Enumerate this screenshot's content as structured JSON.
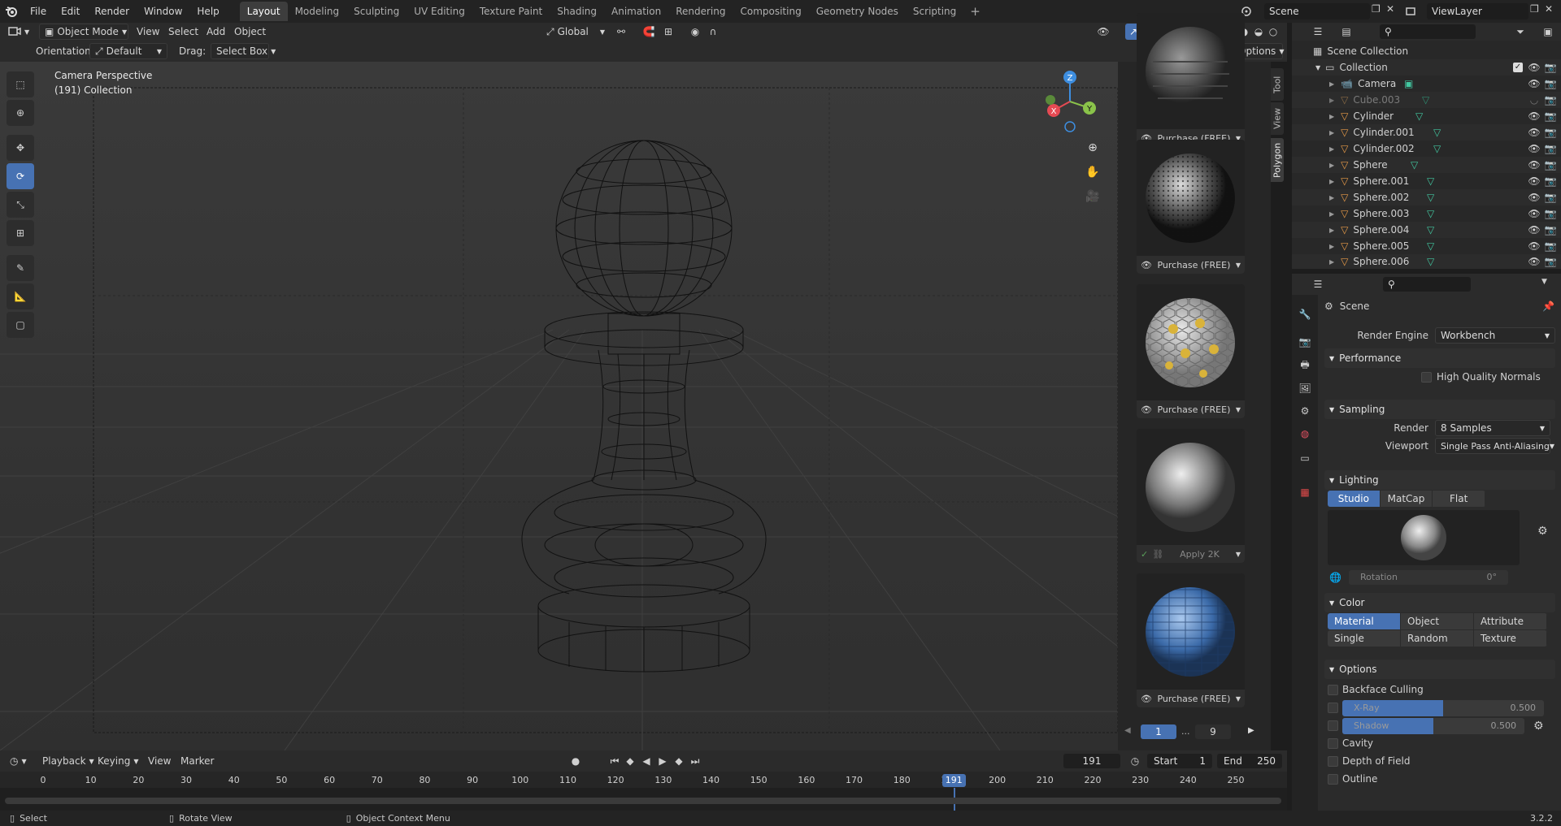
{
  "topbar": {
    "menus": [
      "File",
      "Edit",
      "Render",
      "Window",
      "Help"
    ],
    "workspaces": [
      "Layout",
      "Modeling",
      "Sculpting",
      "UV Editing",
      "Texture Paint",
      "Shading",
      "Animation",
      "Rendering",
      "Compositing",
      "Geometry Nodes",
      "Scripting"
    ],
    "active_workspace": "Layout",
    "scene": "Scene",
    "view_layer": "ViewLayer"
  },
  "viewport_header": {
    "mode": "Object Mode",
    "menus": [
      "View",
      "Select",
      "Add",
      "Object"
    ],
    "transform_orientation": "Global",
    "orientation_label": "Orientation:",
    "orientation_value": "Default",
    "drag_label": "Drag:",
    "drag_value": "Select Box",
    "options": "Options"
  },
  "viewport": {
    "camera_text": "Camera Perspective",
    "collection_text": "(191) Collection",
    "side_tabs": [
      "Tool",
      "View",
      "Polygon"
    ],
    "gizmo_labels": {
      "z": "Z",
      "y": "Y",
      "x": "X"
    }
  },
  "asset_panel": {
    "cards": [
      {
        "label": "Purchase (FREE)",
        "material": "fabric",
        "enabled": true
      },
      {
        "label": "Purchase (FREE)",
        "material": "metal-perforated",
        "enabled": true
      },
      {
        "label": "Purchase (FREE)",
        "material": "hex-tiles",
        "enabled": true
      },
      {
        "label": "Purchase (FREE)",
        "material": "clay",
        "enabled": true
      },
      {
        "label": "Apply 2K",
        "material": "smooth-grey",
        "enabled": false
      },
      {
        "label": "Purchase (FREE)",
        "material": "blue-bricks",
        "enabled": true
      }
    ],
    "page_current": "1",
    "page_sep": "...",
    "page_total": "9"
  },
  "outliner": {
    "root": "Scene Collection",
    "collection": "Collection",
    "items": [
      {
        "name": "Camera",
        "type": "camera",
        "hidden": false
      },
      {
        "name": "Cube.003",
        "type": "mesh",
        "hidden": true
      },
      {
        "name": "Cylinder",
        "type": "mesh",
        "hidden": false
      },
      {
        "name": "Cylinder.001",
        "type": "mesh",
        "hidden": false
      },
      {
        "name": "Cylinder.002",
        "type": "mesh",
        "hidden": false
      },
      {
        "name": "Sphere",
        "type": "mesh",
        "hidden": false
      },
      {
        "name": "Sphere.001",
        "type": "mesh",
        "hidden": false
      },
      {
        "name": "Sphere.002",
        "type": "mesh",
        "hidden": false
      },
      {
        "name": "Sphere.003",
        "type": "mesh",
        "hidden": false
      },
      {
        "name": "Sphere.004",
        "type": "mesh",
        "hidden": false
      },
      {
        "name": "Sphere.005",
        "type": "mesh",
        "hidden": false
      },
      {
        "name": "Sphere.006",
        "type": "mesh",
        "hidden": false
      }
    ]
  },
  "properties": {
    "context": "Scene",
    "render_engine_label": "Render Engine",
    "render_engine": "Workbench",
    "performance": {
      "title": "Performance",
      "high_quality_normals": "High Quality Normals"
    },
    "sampling": {
      "title": "Sampling",
      "render_label": "Render",
      "render_value": "8 Samples",
      "viewport_label": "Viewport",
      "viewport_value": "Single Pass Anti-Aliasing"
    },
    "lighting": {
      "title": "Lighting",
      "modes": [
        "Studio",
        "MatCap",
        "Flat"
      ],
      "active": "Studio",
      "rotation_label": "Rotation",
      "rotation_value": "0°"
    },
    "color": {
      "title": "Color",
      "modes": [
        "Material",
        "Object",
        "Attribute",
        "Single",
        "Random",
        "Texture"
      ],
      "active": "Material"
    },
    "options": {
      "title": "Options",
      "backface_culling": "Backface Culling",
      "xray_label": "X-Ray",
      "xray_value": "0.500",
      "xray_fraction": 0.5,
      "shadow_label": "Shadow",
      "shadow_value": "0.500",
      "shadow_fraction": 0.5,
      "cavity": "Cavity",
      "depth_of_field": "Depth of Field",
      "outline": "Outline"
    }
  },
  "timeline": {
    "menus": [
      "Playback",
      "Keying",
      "View",
      "Marker"
    ],
    "current_frame": "191",
    "start_label": "Start",
    "start": "1",
    "end_label": "End",
    "end": "250",
    "ticks": [
      "0",
      "10",
      "20",
      "30",
      "40",
      "50",
      "60",
      "70",
      "80",
      "90",
      "100",
      "110",
      "120",
      "130",
      "140",
      "150",
      "160",
      "170",
      "180",
      "190",
      "200",
      "210",
      "220",
      "230",
      "240",
      "250"
    ],
    "playhead_label": "191"
  },
  "statusbar": {
    "select": "Select",
    "rotate_view": "Rotate View",
    "context_menu": "Object Context Menu",
    "version": "3.2.2"
  },
  "colors": {
    "accent": "#4772b3",
    "mesh_icon": "#e89b48",
    "data_icon": "#42c7a0",
    "axis_x": "#e54a53",
    "axis_y": "#8ac34a",
    "axis_z": "#3d8ee0"
  }
}
